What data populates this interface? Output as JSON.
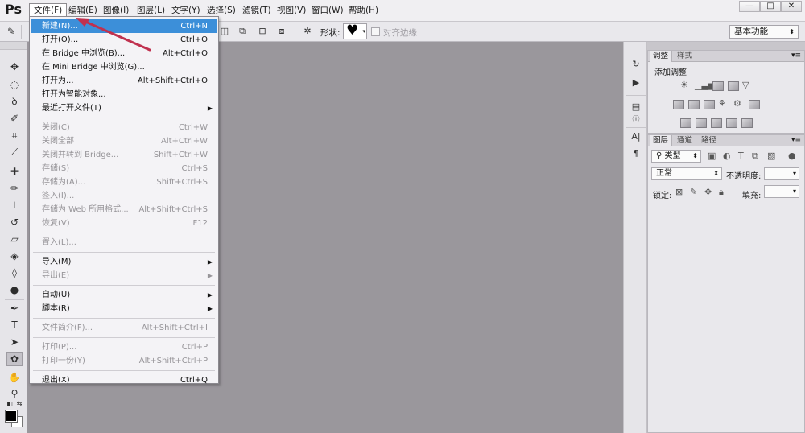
{
  "app": {
    "logo": "Ps"
  },
  "menubar": {
    "items": [
      "文件(F)",
      "编辑(E)",
      "图像(I)",
      "图层(L)",
      "文字(Y)",
      "选择(S)",
      "滤镜(T)",
      "视图(V)",
      "窗口(W)",
      "帮助(H)"
    ],
    "active_index": 0
  },
  "window_controls": {
    "minimize": "—",
    "maximize": "□",
    "close": "✕"
  },
  "options_bar": {
    "shape_label": "形状:",
    "shape_value": "♥",
    "align_edges_label": "对齐边缘",
    "align_edges_checked": false,
    "workspace": "基本功能"
  },
  "file_menu": {
    "groups": [
      [
        {
          "label": "新建(N)...",
          "shortcut": "Ctrl+N",
          "enabled": true,
          "highlighted": true
        },
        {
          "label": "打开(O)...",
          "shortcut": "Ctrl+O",
          "enabled": true
        },
        {
          "label": "在 Bridge 中浏览(B)...",
          "shortcut": "Alt+Ctrl+O",
          "enabled": true
        },
        {
          "label": "在 Mini Bridge 中浏览(G)...",
          "shortcut": "",
          "enabled": true
        },
        {
          "label": "打开为...",
          "shortcut": "Alt+Shift+Ctrl+O",
          "enabled": true
        },
        {
          "label": "打开为智能对象...",
          "shortcut": "",
          "enabled": true
        },
        {
          "label": "最近打开文件(T)",
          "shortcut": "",
          "enabled": true,
          "submenu": true
        }
      ],
      [
        {
          "label": "关闭(C)",
          "shortcut": "Ctrl+W",
          "enabled": false
        },
        {
          "label": "关闭全部",
          "shortcut": "Alt+Ctrl+W",
          "enabled": false
        },
        {
          "label": "关闭并转到 Bridge...",
          "shortcut": "Shift+Ctrl+W",
          "enabled": false
        },
        {
          "label": "存储(S)",
          "shortcut": "Ctrl+S",
          "enabled": false
        },
        {
          "label": "存储为(A)...",
          "shortcut": "Shift+Ctrl+S",
          "enabled": false
        },
        {
          "label": "签入(I)...",
          "shortcut": "",
          "enabled": false
        },
        {
          "label": "存储为 Web 所用格式...",
          "shortcut": "Alt+Shift+Ctrl+S",
          "enabled": false
        },
        {
          "label": "恢复(V)",
          "shortcut": "F12",
          "enabled": false
        }
      ],
      [
        {
          "label": "置入(L)...",
          "shortcut": "",
          "enabled": false
        }
      ],
      [
        {
          "label": "导入(M)",
          "shortcut": "",
          "enabled": true,
          "submenu": true
        },
        {
          "label": "导出(E)",
          "shortcut": "",
          "enabled": false,
          "submenu": true
        }
      ],
      [
        {
          "label": "自动(U)",
          "shortcut": "",
          "enabled": true,
          "submenu": true
        },
        {
          "label": "脚本(R)",
          "shortcut": "",
          "enabled": true,
          "submenu": true
        }
      ],
      [
        {
          "label": "文件简介(F)...",
          "shortcut": "Alt+Shift+Ctrl+I",
          "enabled": false
        }
      ],
      [
        {
          "label": "打印(P)...",
          "shortcut": "Ctrl+P",
          "enabled": false
        },
        {
          "label": "打印一份(Y)",
          "shortcut": "Alt+Shift+Ctrl+P",
          "enabled": false
        }
      ],
      [
        {
          "label": "退出(X)",
          "shortcut": "Ctrl+Q",
          "enabled": true
        }
      ]
    ]
  },
  "adjust_panel": {
    "tabs": [
      "调整",
      "样式"
    ],
    "active_tab": 0,
    "heading": "添加调整"
  },
  "layers_panel": {
    "tabs": [
      "图层",
      "通道",
      "路径"
    ],
    "active_tab": 0,
    "filter_kind": "类型",
    "blend_mode": "正常",
    "opacity_label": "不透明度:",
    "lock_label": "锁定:",
    "fill_label": "填充:"
  },
  "side_panel": {
    "char_icon": "A|",
    "para_icon": "¶"
  },
  "colors": {
    "highlight": "#3c8fd9",
    "workspace_bg": "#9a979c",
    "annotation_arrow": "#c0314f"
  }
}
